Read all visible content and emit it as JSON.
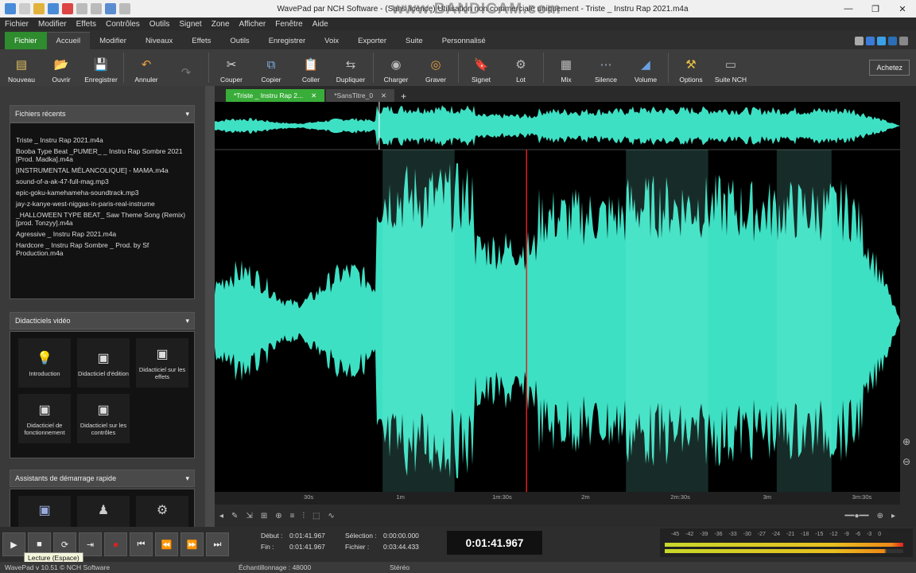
{
  "window": {
    "title": "WavePad par NCH Software - (Sans licence) Utilisation non commerciale uniquement - Triste _ Instru Rap 2021.m4a",
    "watermark": "www.BANDICAM.com"
  },
  "menu": [
    "Fichier",
    "Modifier",
    "Effets",
    "Contrôles",
    "Outils",
    "Signet",
    "Zone",
    "Afficher",
    "Fenêtre",
    "Aide"
  ],
  "ribbon_tabs": [
    "Fichier",
    "Accueil",
    "Modifier",
    "Niveaux",
    "Effets",
    "Outils",
    "Enregistrer",
    "Voix",
    "Exporter",
    "Suite",
    "Personnalisé"
  ],
  "ribbon_active": "Accueil",
  "toolbar": [
    {
      "label": "Nouveau",
      "icon": "new-file-icon",
      "glyph": "▤"
    },
    {
      "label": "Ouvrir",
      "icon": "open-folder-icon",
      "glyph": "📂"
    },
    {
      "label": "Enregistrer",
      "icon": "save-icon",
      "glyph": "💾"
    },
    {
      "label": "Annuler",
      "icon": "undo-icon",
      "glyph": "↶"
    },
    {
      "label": "",
      "icon": "redo-icon",
      "glyph": "↷"
    },
    {
      "label": "Couper",
      "icon": "scissors-icon",
      "glyph": "✂"
    },
    {
      "label": "Copier",
      "icon": "copy-icon",
      "glyph": "⧉"
    },
    {
      "label": "Coller",
      "icon": "paste-icon",
      "glyph": "📋"
    },
    {
      "label": "Dupliquer",
      "icon": "duplicate-icon",
      "glyph": "⇆"
    },
    {
      "label": "Charger",
      "icon": "load-cd-icon",
      "glyph": "◉"
    },
    {
      "label": "Graver",
      "icon": "burn-cd-icon",
      "glyph": "◎"
    },
    {
      "label": "Signet",
      "icon": "bookmark-icon",
      "glyph": "🔖"
    },
    {
      "label": "Lot",
      "icon": "batch-icon",
      "glyph": "⚙"
    },
    {
      "label": "Mix",
      "icon": "mix-icon",
      "glyph": "▦"
    },
    {
      "label": "Silence",
      "icon": "silence-icon",
      "glyph": "⋯"
    },
    {
      "label": "Volume",
      "icon": "volume-icon",
      "glyph": "◢"
    },
    {
      "label": "Options",
      "icon": "options-icon",
      "glyph": "⚒"
    },
    {
      "label": "Suite NCH",
      "icon": "nch-suite-icon",
      "glyph": "▭"
    }
  ],
  "buy_button": "Achetez",
  "recent_files": {
    "header": "Fichiers récents",
    "items": [
      "Triste _ Instru Rap 2021.m4a",
      "Booba Type Beat _PUMER_ _ Instru Rap Sombre 2021 [Prod. Madka].m4a",
      "[INSTRUMENTAL MÉLANCOLIQUE] - MAMA.m4a",
      "sound-of-a-ak-47-full-mag.mp3",
      "epic-goku-kamehameha-soundtrack.mp3",
      "jay-z-kanye-west-niggas-in-paris-real-instrume",
      "_HALLOWEEN TYPE BEAT_ Saw Theme Song (Remix) [prod. Tonzyy].m4a",
      "Agressive _ Instru Rap 2021.m4a",
      "Hardcore _ Instru Rap Sombre _ Prod. by Sf Production.m4a"
    ]
  },
  "tutorials": {
    "header": "Didacticiels vidéo",
    "items": [
      {
        "label": "Introduction",
        "icon": "lightbulb-icon",
        "glyph": "💡"
      },
      {
        "label": "Didacticiel d'édition",
        "icon": "edit-tutorial-icon",
        "glyph": "▣"
      },
      {
        "label": "Didacticiel sur les effets",
        "icon": "effects-tutorial-icon",
        "glyph": "▣"
      },
      {
        "label": "Didacticiel de fonctionnement",
        "icon": "operation-tutorial-icon",
        "glyph": "▣"
      },
      {
        "label": "Didacticiel sur les contrôles",
        "icon": "controls-tutorial-icon",
        "glyph": "▣"
      }
    ]
  },
  "assistants": {
    "header": "Assistants de démarrage rapide"
  },
  "file_tabs": [
    {
      "label": "*Triste _ Instru Rap 2...",
      "active": true
    },
    {
      "label": "*SansTitre_0",
      "active": false
    }
  ],
  "timeline_labels": [
    {
      "label": "30s",
      "pos": 0.13
    },
    {
      "label": "1m",
      "pos": 0.265
    },
    {
      "label": "1m:30s",
      "pos": 0.405
    },
    {
      "label": "2m",
      "pos": 0.535
    },
    {
      "label": "2m:30s",
      "pos": 0.665
    },
    {
      "label": "3m",
      "pos": 0.8
    },
    {
      "label": "3m:30s",
      "pos": 0.93
    }
  ],
  "selection": {
    "debut_label": "Début :",
    "debut": "0:01:41.967",
    "fin_label": "Fin :",
    "fin": "0:01:41.967",
    "sel_label": "Sélection :",
    "sel": "0:00:00.000",
    "fichier_label": "Fichier :",
    "fichier": "0:03:44.433"
  },
  "current_time": "0:01:41.967",
  "tooltip": "Lecture (Espace)",
  "status": {
    "app": "WavePad v 10.51 © NCH Software",
    "sample_rate": "Échantillonnage : 48000",
    "channels": "Stéréo"
  },
  "meter_scale": [
    "-45",
    "-42",
    "-39",
    "-36",
    "-33",
    "-30",
    "-27",
    "-24",
    "-21",
    "-18",
    "-15",
    "-12",
    "-9",
    "-6",
    "-3",
    "0"
  ],
  "colors": {
    "wave": "#3ee0c4",
    "wave_selected": "#7ef2de",
    "cursor": "#e02020",
    "active_tab": "#39ad39"
  }
}
